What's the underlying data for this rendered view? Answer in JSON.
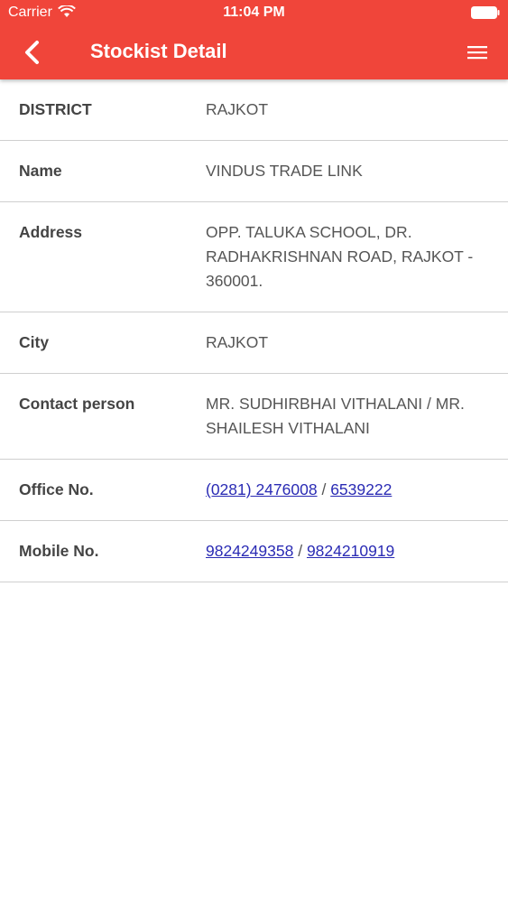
{
  "status_bar": {
    "carrier": "Carrier",
    "time": "11:04 PM"
  },
  "nav": {
    "title": "Stockist Detail",
    "back_icon": "chevron-left-icon",
    "menu_icon": "hamburger-menu-icon"
  },
  "colors": {
    "header": "#f0453a",
    "link": "#2a2bb4"
  },
  "details": {
    "district": {
      "label": "DISTRICT",
      "value": "RAJKOT"
    },
    "name": {
      "label": "Name",
      "value": "VINDUS TRADE LINK"
    },
    "address": {
      "label": "Address",
      "value": "OPP. TALUKA SCHOOL, DR. RADHAKRISHNAN ROAD, RAJKOT - 360001."
    },
    "city": {
      "label": "City",
      "value": "RAJKOT"
    },
    "contact": {
      "label": "Contact person",
      "value": "MR. SUDHIRBHAI VITHALANI / MR. SHAILESH VITHALANI"
    },
    "office": {
      "label": "Office No.",
      "phone1": "(0281) 2476008",
      "separator": "/",
      "phone2": "6539222"
    },
    "mobile": {
      "label": "Mobile No.",
      "phone1": "9824249358",
      "separator": "/",
      "phone2": "9824210919"
    }
  }
}
